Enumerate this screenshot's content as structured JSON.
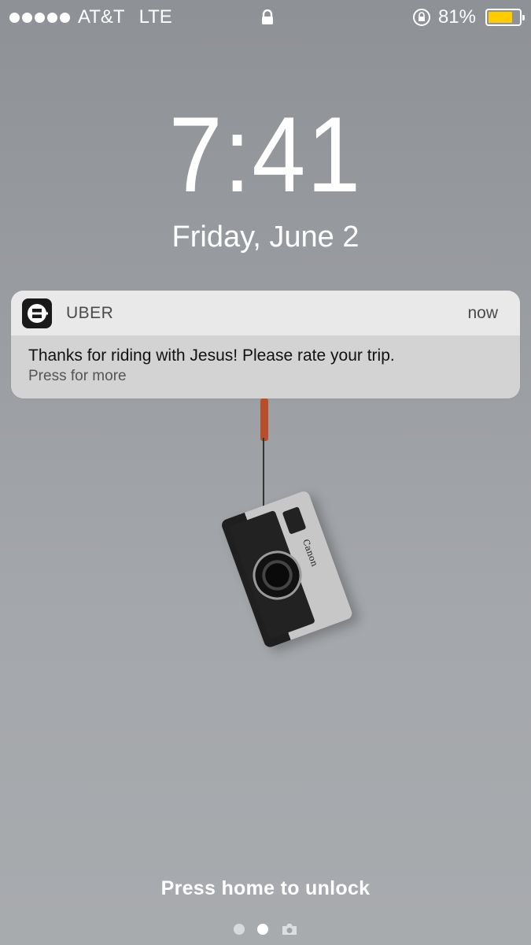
{
  "status_bar": {
    "carrier": "AT&T",
    "network": "LTE",
    "battery_percent": "81%",
    "battery_level": 0.81,
    "battery_color": "#ffcc00",
    "signal_icon": "signal-dots-icon",
    "lock_icon": "padlock-icon",
    "rotation_lock_icon": "rotation-lock-icon"
  },
  "lock_screen": {
    "time": "7:41",
    "date": "Friday, June 2"
  },
  "notification": {
    "app_icon": "uber-logo-icon",
    "app_name": "UBER",
    "time": "now",
    "message": "Thanks for riding with Jesus! Please rate your trip.",
    "sub_text": "Press for more"
  },
  "wallpaper": {
    "camera_brand": "Canon"
  },
  "footer": {
    "unlock_text": "Press home to unlock",
    "page_indicator_icons": [
      "page-dot-icon",
      "page-dot-active-icon",
      "camera-icon"
    ]
  }
}
